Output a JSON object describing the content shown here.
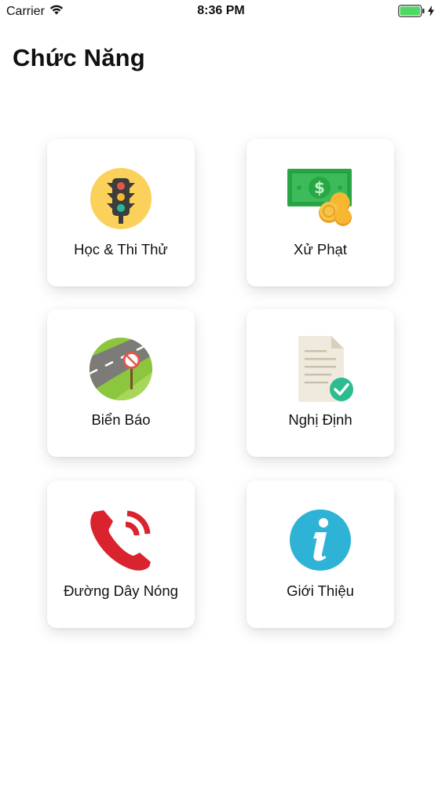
{
  "status_bar": {
    "carrier": "Carrier",
    "time": "8:36 PM",
    "battery_color": "#4cd964",
    "icons": [
      "wifi-icon",
      "battery-icon",
      "charging-bolt-icon"
    ]
  },
  "header": {
    "title": "Chức Năng"
  },
  "menu": {
    "items": [
      {
        "label": "Học & Thi Thử",
        "icon": "traffic-light-icon"
      },
      {
        "label": "Xử Phạt",
        "icon": "money-coins-icon"
      },
      {
        "label": "Biển Báo",
        "icon": "road-sign-icon"
      },
      {
        "label": "Nghị Định",
        "icon": "document-check-icon"
      },
      {
        "label": "Đường Dây Nóng",
        "icon": "phone-icon"
      },
      {
        "label": "Giới Thiệu",
        "icon": "info-icon"
      }
    ]
  },
  "colors": {
    "traffic_light_bg": "#fcd15b",
    "money_green": "#27a744",
    "coin_gold": "#f7b731",
    "phone_red": "#d9232f",
    "info_blue": "#2eb3d7",
    "check_teal": "#2dbb90"
  }
}
